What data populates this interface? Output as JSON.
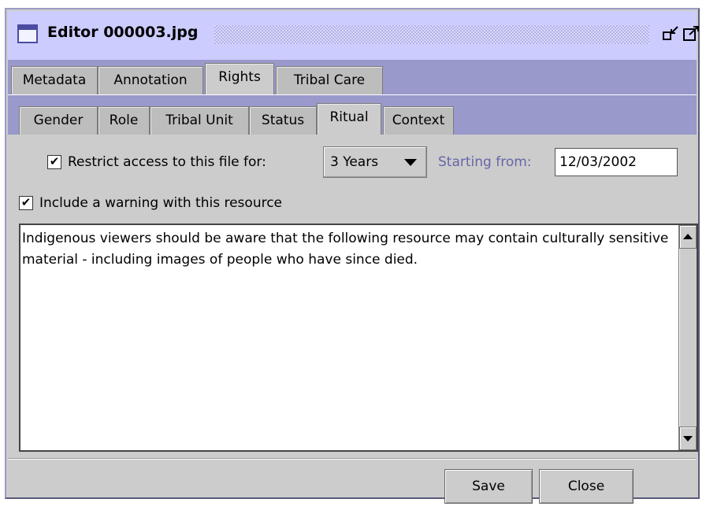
{
  "window": {
    "title": "Editor 000003.jpg"
  },
  "tabs_primary": [
    {
      "label": "Metadata",
      "active": false
    },
    {
      "label": "Annotation",
      "active": false
    },
    {
      "label": "Rights",
      "active": true
    },
    {
      "label": "Tribal Care",
      "active": false
    }
  ],
  "tabs_secondary": [
    {
      "label": "Gender",
      "active": false
    },
    {
      "label": "Role",
      "active": false
    },
    {
      "label": "Tribal Unit",
      "active": false
    },
    {
      "label": "Status",
      "active": false
    },
    {
      "label": "Ritual",
      "active": true
    },
    {
      "label": "Context",
      "active": false
    }
  ],
  "restrict": {
    "checked": true,
    "check_mark": "✔",
    "label": "Restrict access to this file for:",
    "duration_value": "3 Years",
    "starting_label": "Starting from:",
    "starting_value": "12/03/2002"
  },
  "warning": {
    "checked": true,
    "check_mark": "✔",
    "label": "Include a warning with this resource",
    "text": "Indigenous viewers should be aware that the following resource may contain culturally sensitive material - including images of people who have since died."
  },
  "buttons": {
    "save": "Save",
    "close": "Close"
  },
  "colors": {
    "title_bar": "#ccccff",
    "tab_strip": "#9999cc",
    "panel": "#cccccc"
  }
}
